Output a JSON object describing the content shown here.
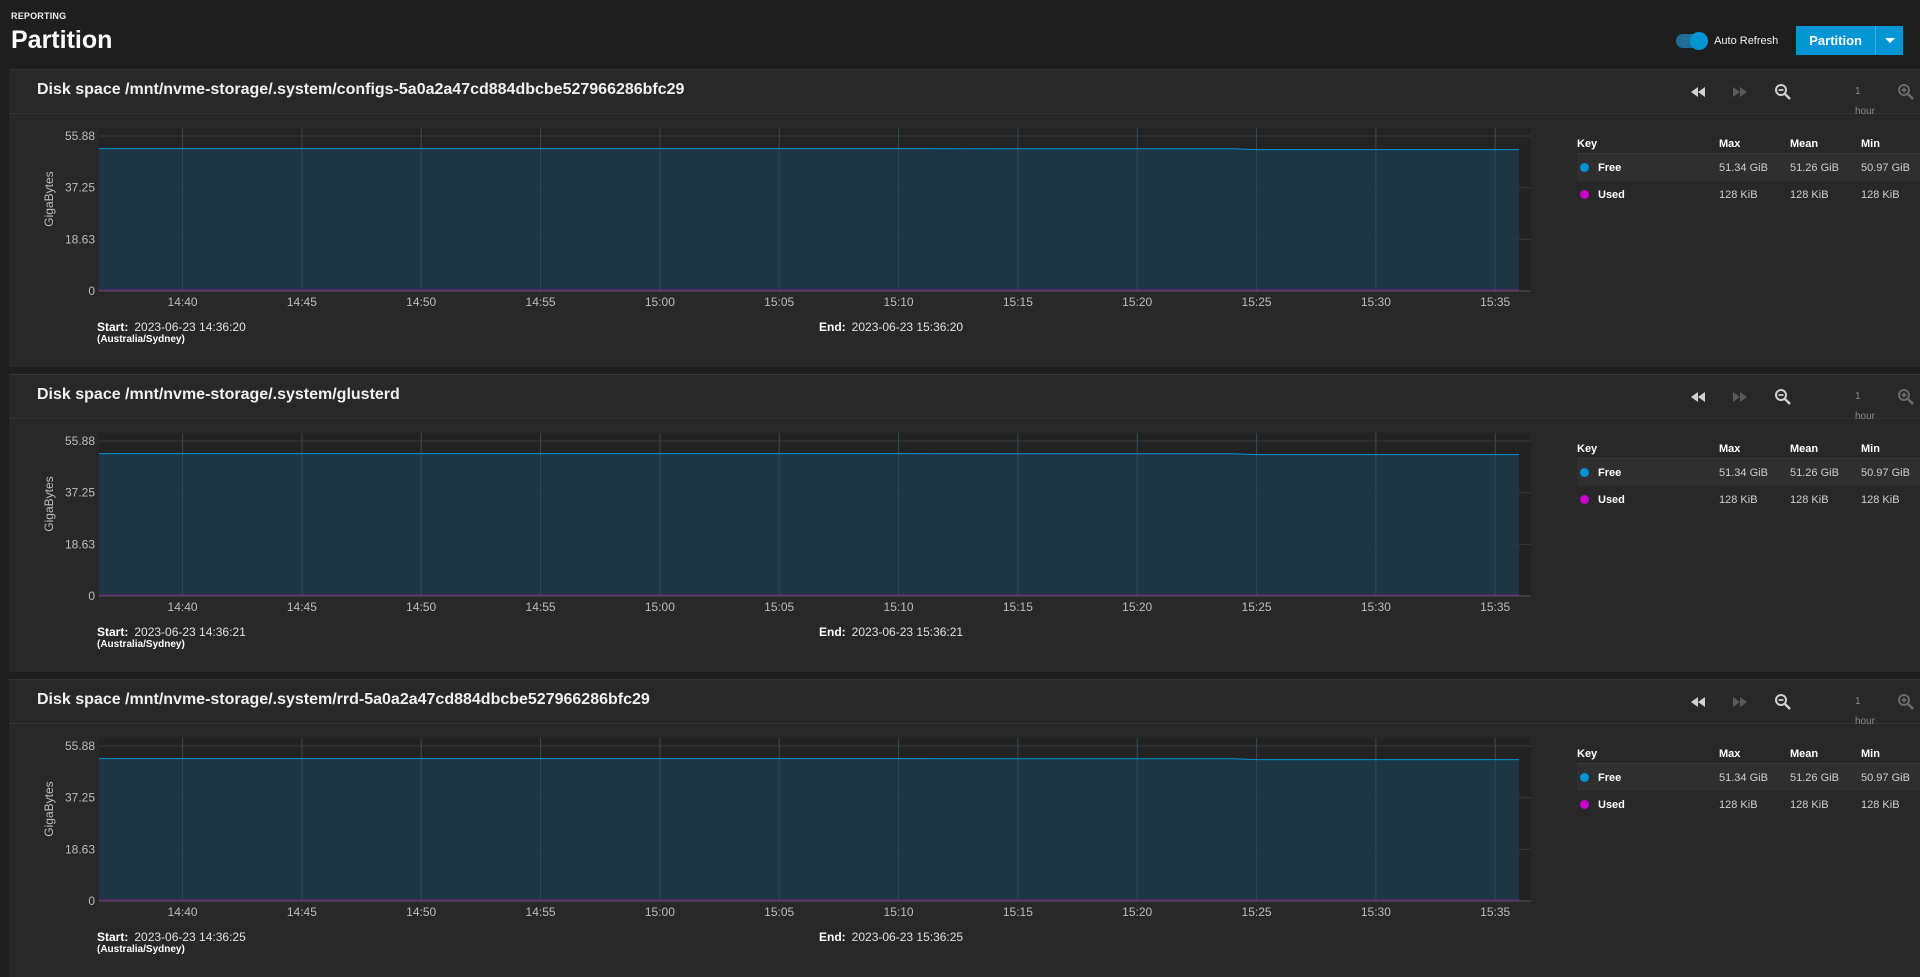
{
  "header": {
    "breadcrumb": "REPORTING",
    "title": "Partition",
    "auto_refresh_label": "Auto Refresh",
    "auto_refresh_on": true,
    "dropdown_label": "Partition"
  },
  "colors": {
    "accent": "#0095d5",
    "free": "#0095d5",
    "used": "#cc00cc",
    "area": "#1d3a4a"
  },
  "icons": {
    "back": "rewind-icon",
    "forward": "fast-forward-icon",
    "zoom_out": "zoom-out-icon",
    "zoom_in": "zoom-in-icon"
  },
  "legend_headers": {
    "key": "Key",
    "max": "Max",
    "mean": "Mean",
    "min": "Min"
  },
  "cards": [
    {
      "title": "Disk space /mnt/nvme-storage/.system/configs-5a0a2a47cd884dbcbe527966286bfc29",
      "range": "1 hour",
      "start_label": "Start:",
      "start_value": "2023-06-23 14:36:20",
      "timezone": "(Australia/Sydney)",
      "end_label": "End:",
      "end_value": "2023-06-23 15:36:20",
      "legend": [
        {
          "name": "Free",
          "max": "51.34 GiB",
          "mean": "51.26 GiB",
          "min": "50.97 GiB"
        },
        {
          "name": "Used",
          "max": "128 KiB",
          "mean": "128 KiB",
          "min": "128 KiB"
        }
      ]
    },
    {
      "title": "Disk space /mnt/nvme-storage/.system/glusterd",
      "range": "1 hour",
      "start_label": "Start:",
      "start_value": "2023-06-23 14:36:21",
      "timezone": "(Australia/Sydney)",
      "end_label": "End:",
      "end_value": "2023-06-23 15:36:21",
      "legend": [
        {
          "name": "Free",
          "max": "51.34 GiB",
          "mean": "51.26 GiB",
          "min": "50.97 GiB"
        },
        {
          "name": "Used",
          "max": "128 KiB",
          "mean": "128 KiB",
          "min": "128 KiB"
        }
      ]
    },
    {
      "title": "Disk space /mnt/nvme-storage/.system/rrd-5a0a2a47cd884dbcbe527966286bfc29",
      "range": "1 hour",
      "start_label": "Start:",
      "start_value": "2023-06-23 14:36:25",
      "timezone": "(Australia/Sydney)",
      "end_label": "End:",
      "end_value": "2023-06-23 15:36:25",
      "legend": [
        {
          "name": "Free",
          "max": "51.34 GiB",
          "mean": "51.26 GiB",
          "min": "50.97 GiB"
        },
        {
          "name": "Used",
          "max": "128 KiB",
          "mean": "128 KiB",
          "min": "128 KiB"
        }
      ]
    }
  ],
  "chart_data": [
    {
      "type": "area",
      "ylabel": "GigaBytes",
      "yticks": [
        "0",
        "18.63",
        "37.25",
        "55.88"
      ],
      "ylim": [
        0,
        55.88
      ],
      "xticks": [
        "14:40",
        "14:45",
        "14:50",
        "14:55",
        "15:00",
        "15:05",
        "15:10",
        "15:15",
        "15:20",
        "15:25",
        "15:30",
        "15:35"
      ],
      "x_minutes": [
        0,
        5,
        10,
        15,
        20,
        25,
        30,
        35,
        40,
        45,
        50,
        55,
        59
      ],
      "x_start_minute": -3.5,
      "series": [
        {
          "name": "Free",
          "x": [
            "14:36",
            "14:40",
            "14:45",
            "14:50",
            "14:55",
            "15:00",
            "15:05",
            "15:10",
            "15:15",
            "15:20",
            "15:24",
            "15:25",
            "15:30",
            "15:36"
          ],
          "values": [
            51.34,
            51.34,
            51.33,
            51.33,
            51.32,
            51.32,
            51.31,
            51.31,
            51.3,
            51.3,
            51.29,
            50.97,
            50.97,
            50.97
          ]
        },
        {
          "name": "Used",
          "x": [
            "14:36",
            "15:36"
          ],
          "values": [
            0.000122,
            0.000122
          ]
        }
      ]
    },
    {
      "type": "area",
      "ylabel": "GigaBytes",
      "yticks": [
        "0",
        "18.63",
        "37.25",
        "55.88"
      ],
      "ylim": [
        0,
        55.88
      ],
      "xticks": [
        "14:40",
        "14:45",
        "14:50",
        "14:55",
        "15:00",
        "15:05",
        "15:10",
        "15:15",
        "15:20",
        "15:25",
        "15:30",
        "15:35"
      ],
      "x_start_minute": -3.5,
      "series": [
        {
          "name": "Free",
          "x": [
            "14:36",
            "14:40",
            "14:45",
            "14:50",
            "14:55",
            "15:00",
            "15:05",
            "15:10",
            "15:15",
            "15:20",
            "15:24",
            "15:25",
            "15:30",
            "15:36"
          ],
          "values": [
            51.34,
            51.34,
            51.33,
            51.33,
            51.32,
            51.32,
            51.31,
            51.31,
            51.3,
            51.3,
            51.29,
            50.97,
            50.97,
            50.97
          ]
        },
        {
          "name": "Used",
          "x": [
            "14:36",
            "15:36"
          ],
          "values": [
            0.000122,
            0.000122
          ]
        }
      ]
    },
    {
      "type": "area",
      "ylabel": "GigaBytes",
      "yticks": [
        "0",
        "18.63",
        "37.25",
        "55.88"
      ],
      "ylim": [
        0,
        55.88
      ],
      "xticks": [
        "14:40",
        "14:45",
        "14:50",
        "14:55",
        "15:00",
        "15:05",
        "15:10",
        "15:15",
        "15:20",
        "15:25",
        "15:30",
        "15:35"
      ],
      "x_start_minute": -3.5,
      "series": [
        {
          "name": "Free",
          "x": [
            "14:36",
            "14:40",
            "14:45",
            "14:50",
            "14:55",
            "15:00",
            "15:05",
            "15:10",
            "15:15",
            "15:20",
            "15:24",
            "15:25",
            "15:30",
            "15:36"
          ],
          "values": [
            51.34,
            51.34,
            51.33,
            51.33,
            51.32,
            51.32,
            51.31,
            51.31,
            51.3,
            51.3,
            51.29,
            50.97,
            50.97,
            50.97
          ]
        },
        {
          "name": "Used",
          "x": [
            "14:36",
            "15:36"
          ],
          "values": [
            0.000122,
            0.000122
          ]
        }
      ]
    }
  ]
}
